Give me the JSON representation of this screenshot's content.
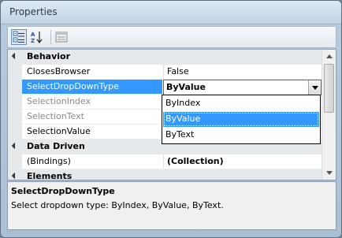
{
  "window": {
    "title": "Properties"
  },
  "toolbar": {
    "buttons": [
      {
        "icon": "categorized-icon",
        "active": true
      },
      {
        "icon": "alphabetical-sort-icon",
        "active": false
      },
      {
        "icon": "property-pages-icon",
        "active": false
      }
    ]
  },
  "grid": {
    "categories": {
      "behavior": "Behavior",
      "data_driven": "Data Driven",
      "elements": "Elements"
    },
    "rows": {
      "closes_browser": {
        "name": "ClosesBrowser",
        "value": "False"
      },
      "select_dropdown_type": {
        "name": "SelectDropDownType",
        "value": "ByValue"
      },
      "selection_index": {
        "name": "SelectionIndex",
        "value": ""
      },
      "selection_text": {
        "name": "SelectionText",
        "value": ""
      },
      "selection_value": {
        "name": "SelectionValue",
        "value": ""
      },
      "bindings": {
        "name": "(Bindings)",
        "value": "(Collection)"
      }
    },
    "dropdown": {
      "options": [
        "ByIndex",
        "ByValue",
        "ByText"
      ],
      "selected": "ByValue"
    }
  },
  "description": {
    "title": "SelectDropDownType",
    "text": "Select dropdown type: ByIndex, ByValue, ByText."
  },
  "colors": {
    "selection": "#3399ff",
    "category_bg": "#e6e9ec"
  }
}
